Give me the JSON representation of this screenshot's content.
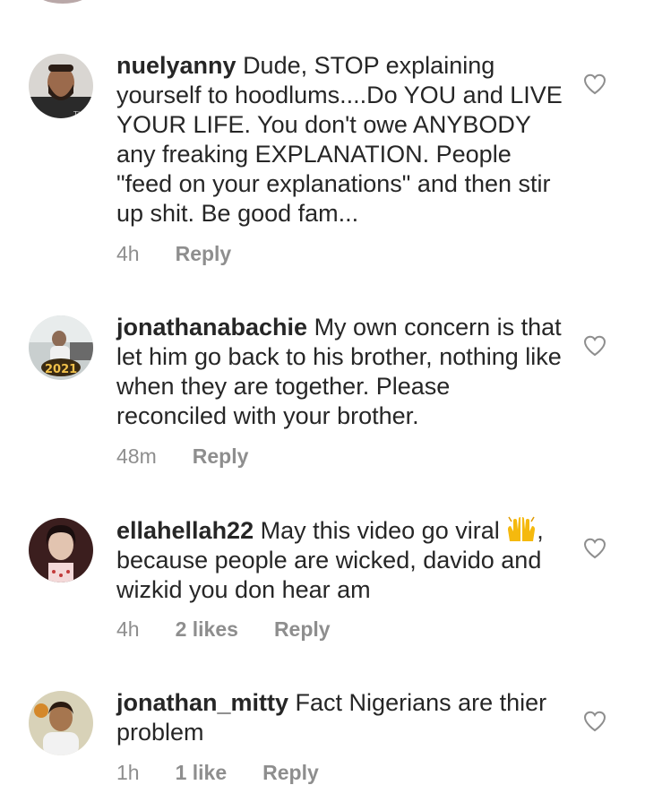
{
  "comments": [
    {
      "username": "nuelyanny",
      "text": "Dude, STOP explaining yourself to hoodlums....Do YOU and LIVE YOUR LIFE. You don't owe ANYBODY any freaking EXPLANATION. People \"feed on your explanations\" and then stir up shit. Be good fam...",
      "time": "4h",
      "likes": "",
      "reply_label": "Reply",
      "avatar_icon": "profile-photo-man-beard"
    },
    {
      "username": "jonathanabachie",
      "text": "My own concern is that let him go back to his brother, nothing like when they are together. Please reconciled with your brother.",
      "time": "48m",
      "likes": "",
      "reply_label": "Reply",
      "avatar_icon": "profile-photo-2021-badge"
    },
    {
      "username": "ellahellah22",
      "text_before_emoji": "May this video go viral ",
      "emoji": "raising-hands",
      "text_after_emoji": ", because people are wicked, davido and wizkid you don hear am",
      "time": "4h",
      "likes": "2 likes",
      "reply_label": "Reply",
      "avatar_icon": "profile-photo-woman"
    },
    {
      "username": "jonathan_mitty",
      "text": "Fact Nigerians are thier problem",
      "time": "1h",
      "likes": "1 like",
      "reply_label": "Reply",
      "avatar_icon": "profile-photo-man"
    }
  ],
  "colors": {
    "text": "#262626",
    "meta": "#8e8e8e",
    "background": "#ffffff",
    "heart_outline": "#8e8e8e"
  }
}
